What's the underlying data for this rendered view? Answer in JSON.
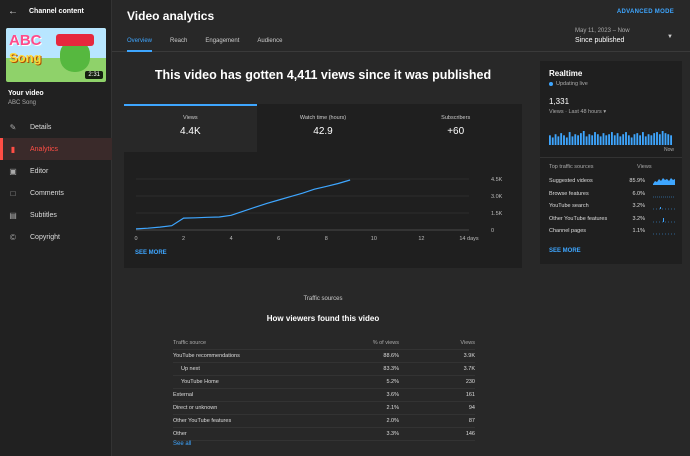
{
  "sidebar": {
    "title": "Channel content",
    "duration": "2:31",
    "thumb_text_1": "ABC",
    "thumb_text_2": "Song",
    "your_video": "Your video",
    "video_title": "ABC Song",
    "items": [
      {
        "label": "Details",
        "icon": "pencil-icon"
      },
      {
        "label": "Analytics",
        "icon": "analytics-icon"
      },
      {
        "label": "Editor",
        "icon": "film-icon"
      },
      {
        "label": "Comments",
        "icon": "comment-icon"
      },
      {
        "label": "Subtitles",
        "icon": "subtitles-icon"
      },
      {
        "label": "Copyright",
        "icon": "copyright-icon"
      }
    ]
  },
  "header": {
    "title": "Video analytics",
    "advanced_mode": "ADVANCED MODE",
    "tabs": [
      "Overview",
      "Reach",
      "Engagement",
      "Audience"
    ],
    "period_range": "May 11, 2023 – Now",
    "period_label": "Since published"
  },
  "main": {
    "headline": "This video has gotten 4,411 views since it was published",
    "metrics": [
      {
        "label": "Views",
        "value": "4.4K"
      },
      {
        "label": "Watch time (hours)",
        "value": "42.9"
      },
      {
        "label": "Subscribers",
        "value": "+60"
      }
    ],
    "see_more": "SEE MORE"
  },
  "chart_data": {
    "type": "line",
    "x": [
      0,
      0.5,
      1,
      1.5,
      2,
      2.5,
      3,
      3.5,
      4,
      4.5,
      5,
      5.5,
      6,
      6.5,
      7,
      7.5,
      8,
      8.5,
      9
    ],
    "series": [
      {
        "values": [
          100,
          160,
          260,
          380,
          1050,
          1080,
          1120,
          1150,
          1300,
          1650,
          2000,
          2350,
          2650,
          2950,
          3250,
          3600,
          3850,
          4100,
          4411
        ]
      }
    ],
    "xticks": [
      "0",
      "2",
      "4",
      "6",
      "8",
      "10",
      "12",
      "14 days"
    ],
    "xtick_values": [
      0,
      2,
      4,
      6,
      8,
      10,
      12,
      14
    ],
    "yticks": [
      "0",
      "1.5K",
      "3.0K",
      "4.5K"
    ],
    "ytick_values": [
      0,
      1500,
      3000,
      4500
    ],
    "xlim": [
      0,
      14
    ],
    "ylim": [
      0,
      4500
    ],
    "grid": true,
    "color": "#3ea6ff"
  },
  "traffic": {
    "caption": "Traffic sources",
    "title": "How viewers found this video",
    "headers": [
      "Traffic source",
      "% of views",
      "Views"
    ],
    "rows": [
      {
        "source": "YouTube recommendations",
        "pct": "88.6%",
        "views": "3.9K",
        "sub": false
      },
      {
        "source": "Up next",
        "pct": "83.3%",
        "views": "3.7K",
        "sub": true
      },
      {
        "source": "YouTube Home",
        "pct": "5.2%",
        "views": "230",
        "sub": true
      },
      {
        "source": "External",
        "pct": "3.6%",
        "views": "161",
        "sub": false
      },
      {
        "source": "Direct or unknown",
        "pct": "2.1%",
        "views": "94",
        "sub": false
      },
      {
        "source": "Other YouTube features",
        "pct": "2.0%",
        "views": "87",
        "sub": false
      },
      {
        "source": "Other",
        "pct": "3.3%",
        "views": "146",
        "sub": false
      }
    ],
    "see_all": "See all"
  },
  "realtime": {
    "title": "Realtime",
    "live": "Updating live",
    "count": "1,331",
    "sub": "Views · Last 48 hours",
    "now": "Now",
    "bars": [
      9,
      7,
      10,
      8,
      11,
      9,
      7,
      12,
      8,
      10,
      9,
      11,
      13,
      8,
      10,
      9,
      12,
      10,
      8,
      11,
      9,
      10,
      12,
      9,
      11,
      8,
      10,
      12,
      9,
      7,
      10,
      11,
      9,
      12,
      8,
      10,
      9,
      11,
      12,
      10,
      13,
      11,
      10,
      9
    ],
    "th_source": "Top traffic sources",
    "th_views": "Views",
    "sources": [
      {
        "name": "Suggested videos",
        "pct": "85.9%"
      },
      {
        "name": "Browse features",
        "pct": "6.0%"
      },
      {
        "name": "YouTube search",
        "pct": "3.2%"
      },
      {
        "name": "Other YouTube features",
        "pct": "3.2%"
      },
      {
        "name": "Channel pages",
        "pct": "1.1%"
      }
    ],
    "see_more": "SEE MORE",
    "accent": "#3ea6ff"
  }
}
